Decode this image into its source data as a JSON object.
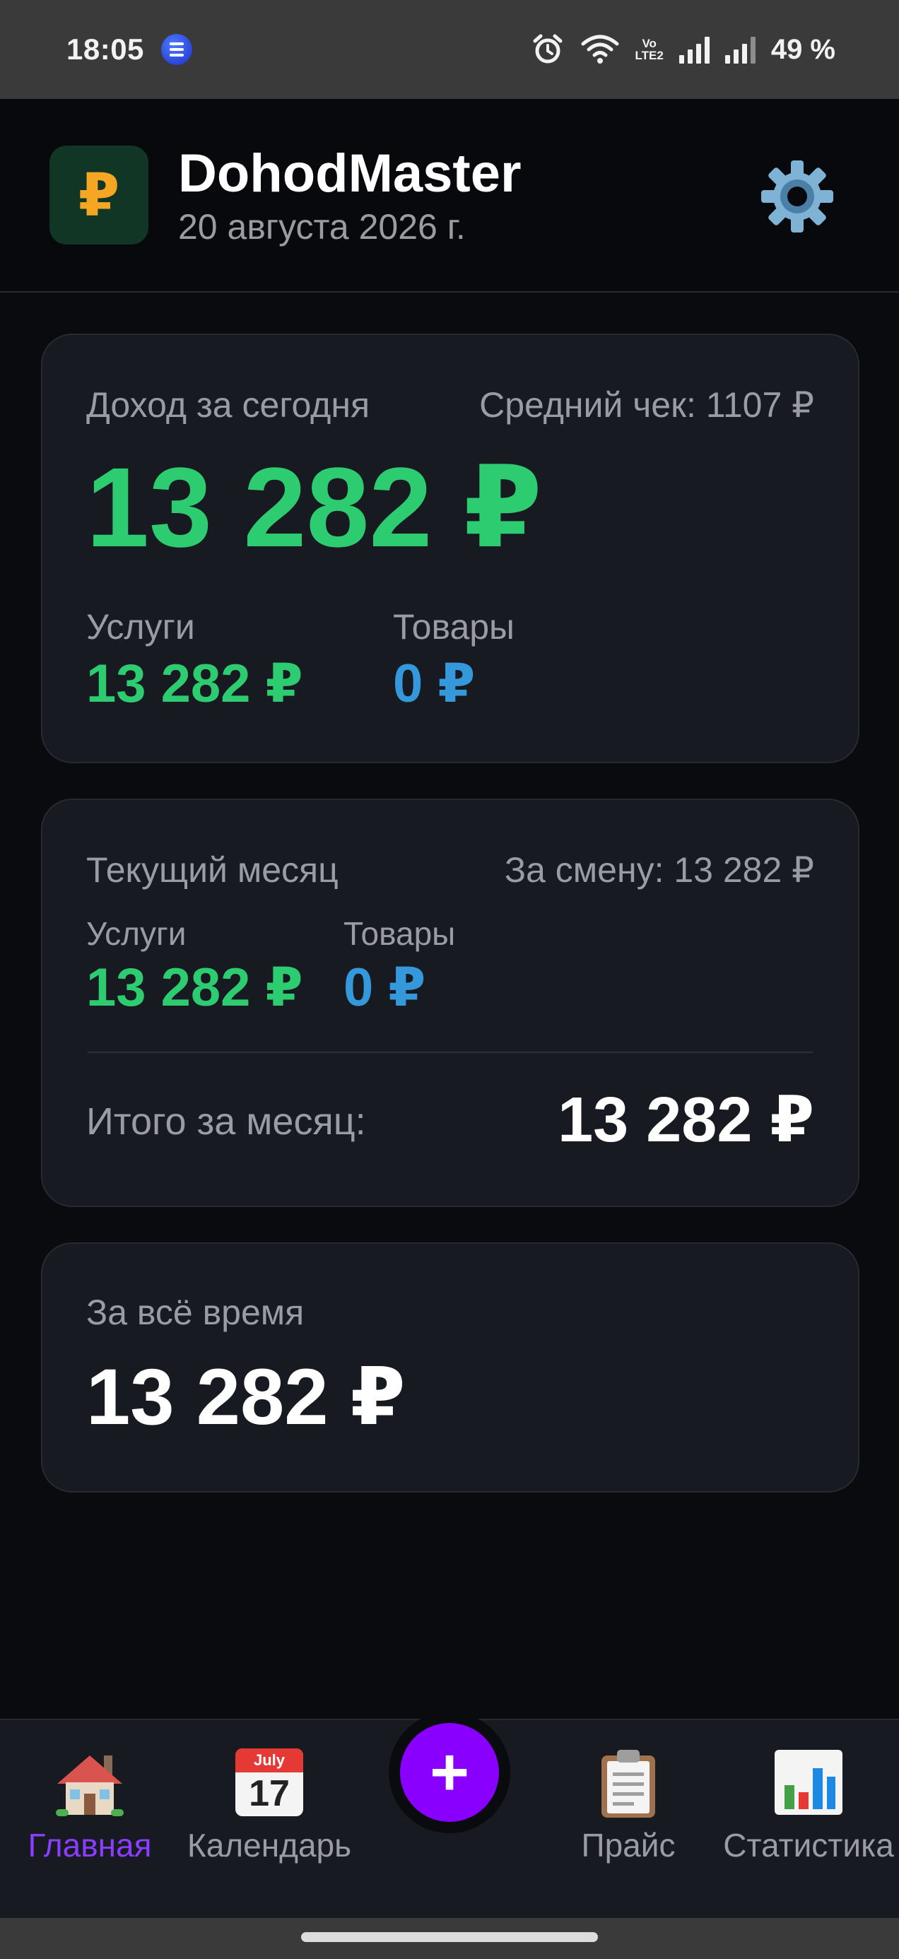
{
  "status_bar": {
    "time": "18:05",
    "battery": "49 %",
    "network_label_top": "Vo",
    "network_label_bottom": "LTE2"
  },
  "header": {
    "logo_symbol": "₽",
    "title": "DohodMaster",
    "date": "20 августа 2026 г.",
    "settings_icon": "gear-icon"
  },
  "today": {
    "label": "Доход за сегодня",
    "avg_check": "Средний чек: 1107 ₽",
    "total": "13 282 ₽",
    "services_label": "Услуги",
    "services_value": "13 282 ₽",
    "goods_label": "Товары",
    "goods_value": "0 ₽"
  },
  "month": {
    "label": "Текущий месяц",
    "shift": "За смену: 13 282 ₽",
    "services_label": "Услуги",
    "services_value": "13 282 ₽",
    "goods_label": "Товары",
    "goods_value": "0 ₽",
    "total_label": "Итого за месяц:",
    "total_value": "13 282 ₽"
  },
  "all_time": {
    "label": "За всё время",
    "total": "13 282 ₽"
  },
  "nav": {
    "home": "Главная",
    "calendar": "Календарь",
    "calendar_month": "July",
    "calendar_day": "17",
    "add_symbol": "+",
    "price": "Прайс",
    "stats": "Статистика"
  },
  "colors": {
    "accent_green": "#2ecc71",
    "accent_blue": "#3498db",
    "accent_purple": "#8a00ff",
    "logo_bg": "#123626",
    "logo_symbol": "#f5a623"
  }
}
